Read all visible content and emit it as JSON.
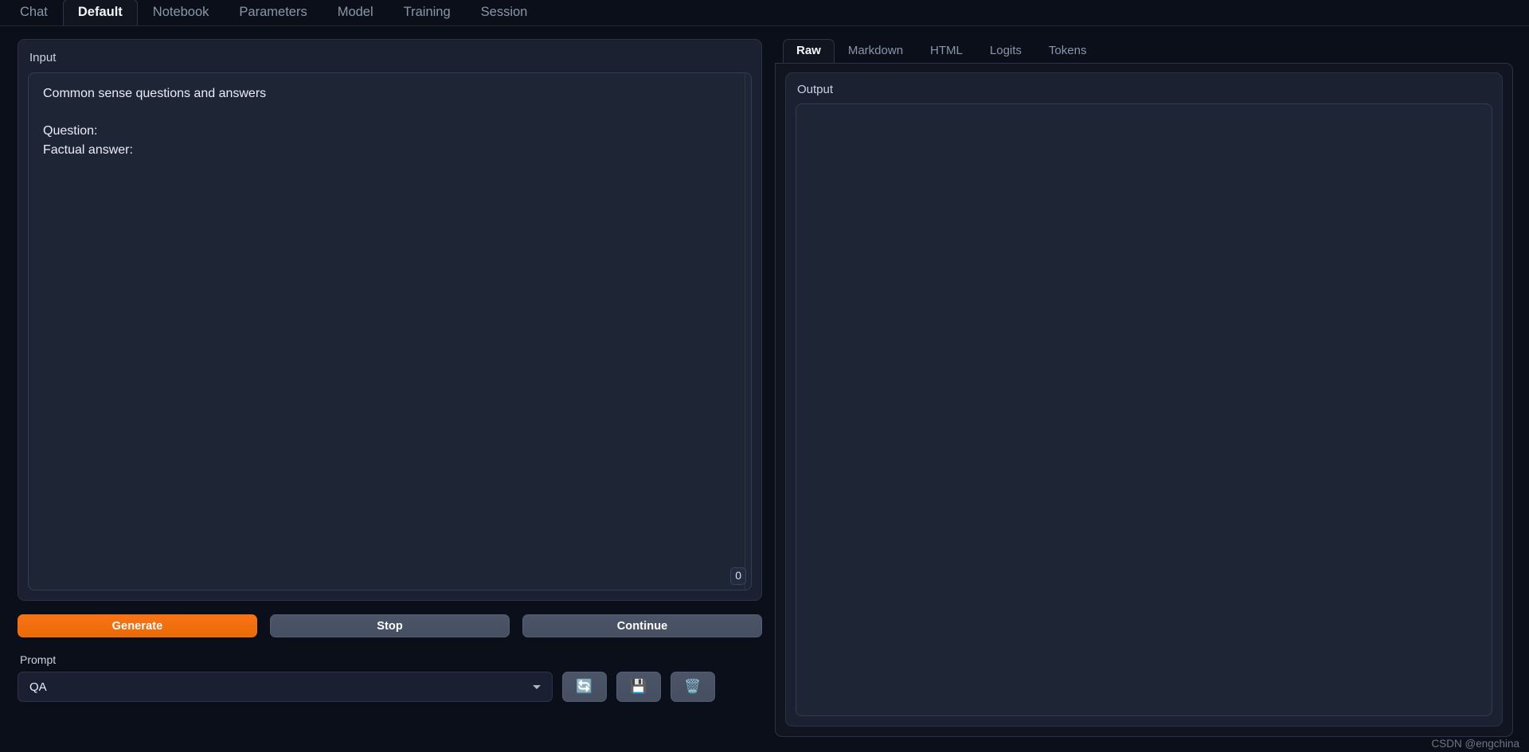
{
  "topnav": {
    "tabs": [
      {
        "label": "Chat",
        "active": false
      },
      {
        "label": "Default",
        "active": true
      },
      {
        "label": "Notebook",
        "active": false
      },
      {
        "label": "Parameters",
        "active": false
      },
      {
        "label": "Model",
        "active": false
      },
      {
        "label": "Training",
        "active": false
      },
      {
        "label": "Session",
        "active": false
      }
    ]
  },
  "input_panel": {
    "label": "Input",
    "textarea_value": "Common sense questions and answers\n\nQuestion:\nFactual answer:",
    "token_count": "0"
  },
  "actions": {
    "generate_label": "Generate",
    "stop_label": "Stop",
    "continue_label": "Continue"
  },
  "prompt": {
    "label": "Prompt",
    "selected_value": "QA",
    "options": [
      "QA"
    ],
    "buttons": [
      {
        "name": "refresh-icon",
        "glyph": "🔄"
      },
      {
        "name": "save-icon",
        "glyph": "💾"
      },
      {
        "name": "delete-icon",
        "glyph": "🗑️"
      }
    ]
  },
  "output_panel": {
    "tabs": [
      {
        "label": "Raw",
        "active": true
      },
      {
        "label": "Markdown",
        "active": false
      },
      {
        "label": "HTML",
        "active": false
      },
      {
        "label": "Logits",
        "active": false
      },
      {
        "label": "Tokens",
        "active": false
      }
    ],
    "label": "Output",
    "text": ""
  },
  "watermark": "CSDN @engchina",
  "colors": {
    "accent_orange": "#f97316",
    "page_bg": "#0b0f19",
    "panel_bg": "#1b2130",
    "field_bg": "#1e2636",
    "tabpanel_bg": "#11151f",
    "border": "#2a3446",
    "text_primary": "#e8edf6",
    "text_muted": "#8b96aa"
  }
}
